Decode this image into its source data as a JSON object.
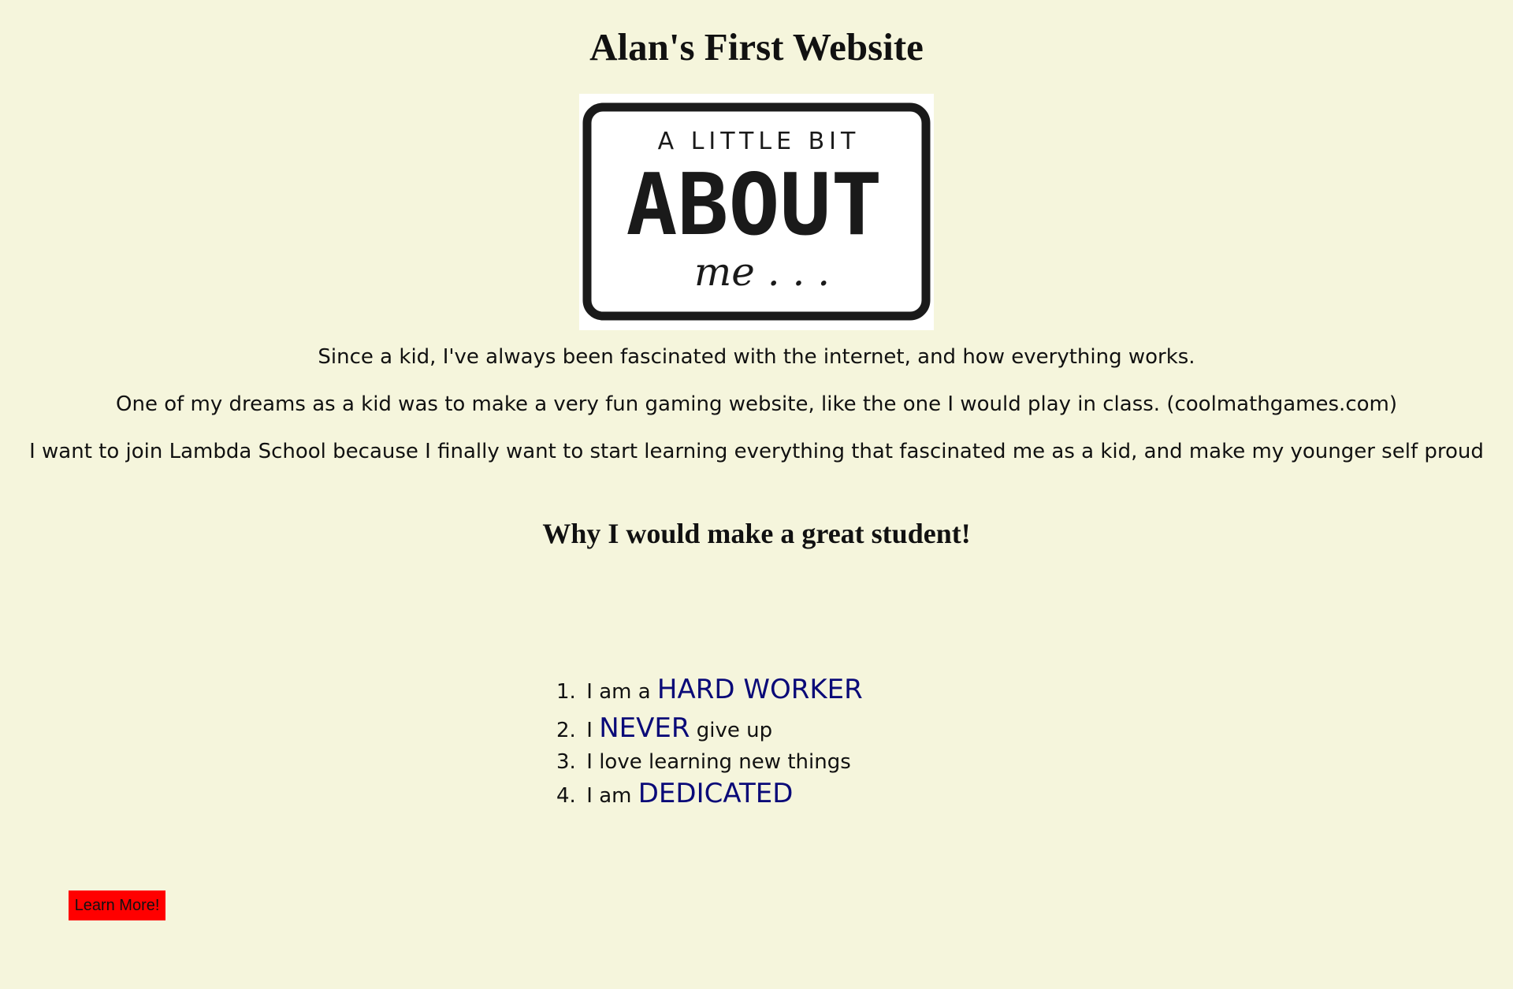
{
  "page": {
    "title": "Alan's First Website"
  },
  "about_image": {
    "line1": "A LITTLE BIT",
    "line2": "ABOUT",
    "line3": "me . . ."
  },
  "intro": {
    "paragraphs": [
      "Since a kid, I've always been fascinated with the internet, and how everything works.",
      "One of my dreams as a kid was to make a very fun gaming website, like the one I would play in class. (coolmathgames.com)",
      "I want to join Lambda School because I finally want to start learning everything that fascinated me as a kid, and make my younger self proud"
    ]
  },
  "reasons": {
    "heading": "Why I would make a great student!",
    "items": [
      {
        "number": "1.",
        "before": "I am a",
        "highlight": "HARD WORKER",
        "after": ""
      },
      {
        "number": "2.",
        "before": "I",
        "highlight": "NEVER",
        "after": "give up"
      },
      {
        "number": "3.",
        "before": "I love learning new things",
        "highlight": "",
        "after": ""
      },
      {
        "number": "4.",
        "before": "I am",
        "highlight": "DEDICATED",
        "after": ""
      }
    ]
  },
  "cta": {
    "label": "Learn More!"
  },
  "colors": {
    "background": "#f5f5dc",
    "highlight": "#0a0a78",
    "button": "#ff0000"
  }
}
